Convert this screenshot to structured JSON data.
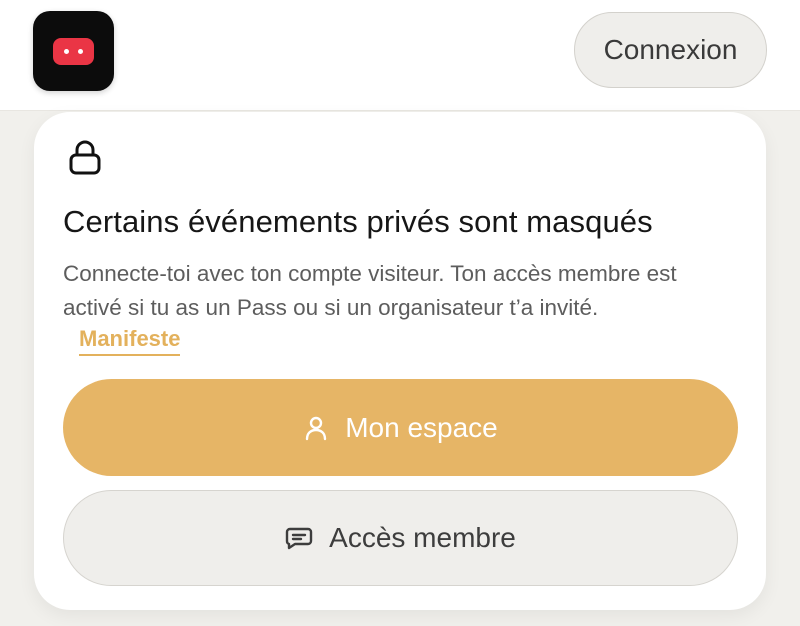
{
  "header": {
    "logo_icon": "app-logo-icon",
    "login_label": "Connexion"
  },
  "card": {
    "icon": "lock-icon",
    "title": "Certains événements privés sont masqués",
    "description_lines": [
      "Connecte-toi avec ton compte visiteur. Ton accès membre est",
      "activé si tu as un Pass ou si un organisateur t’a invité."
    ],
    "link_label": "Manifeste",
    "primary_button": {
      "label": "Mon espace",
      "icon": "user-icon"
    },
    "secondary_button": {
      "label": "Accès membre",
      "icon": "chat-icon"
    }
  },
  "colors": {
    "accent": "#e6b566",
    "link": "#e3b15c",
    "logo_bg": "#0c0c0c",
    "logo_face": "#ea3545"
  }
}
